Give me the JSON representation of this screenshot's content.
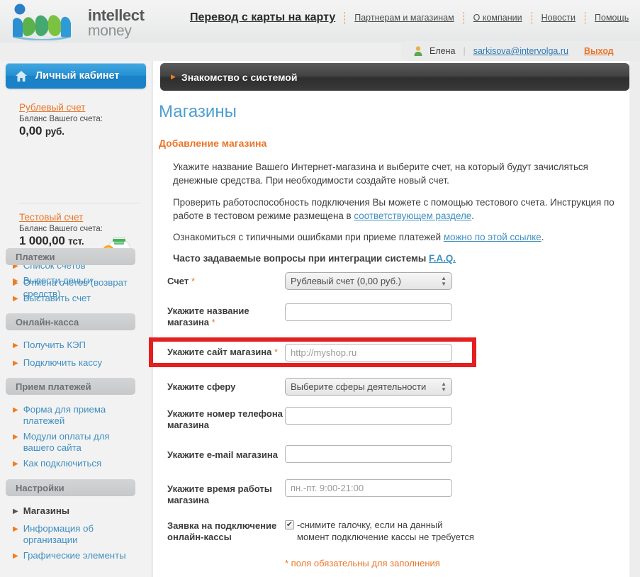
{
  "brand": {
    "name_line1": "intellect",
    "name_line2": "money",
    "logo_icon": "im-wave-logo",
    "accent_orange": "#e8762a",
    "accent_blue": "#3f8fc0",
    "highlight_red": "#e41f1f"
  },
  "topnav": {
    "primary": "Перевод с карты на карту",
    "items": [
      "Партнерам и магазинам",
      "О компании",
      "Новости",
      "Помощь"
    ]
  },
  "userbar": {
    "avatar_icon": "user-icon",
    "name": "Елена",
    "divider": "|",
    "email": "sarkisova@intervolga.ru",
    "logout": "Выход"
  },
  "sidebar": {
    "cabinet_button": {
      "icon": "home-icon",
      "label": "Личный кабинет"
    },
    "accounts": [
      {
        "link": "Рублевый счет",
        "balance_label": "Баланс Вашего счета:",
        "amount": "0,00",
        "currency": "руб."
      },
      {
        "link": "Тестовый счет",
        "balance_label": "Баланс Вашего счета:",
        "amount": "1 000,00",
        "currency": "тст.",
        "icon": "piggy-bank-icon"
      }
    ],
    "top_links": [
      "Список счетов",
      "Отмена счетов (возврат средств)"
    ],
    "groups": [
      {
        "title": "Платежи",
        "items": [
          "Вывести деньги",
          "Выставить счет"
        ]
      },
      {
        "title": "Онлайн-касса",
        "items": [
          "Получить КЭП",
          "Подключить кассу"
        ]
      },
      {
        "title": "Прием платежей",
        "items": [
          "Форма для приема платежей",
          "Модули оплаты для вашего сайта",
          "Как подключиться"
        ]
      },
      {
        "title": "Настройки",
        "items": [
          "Магазины",
          "Информация об организации",
          "Графические элементы"
        ]
      }
    ],
    "active_item": "Магазины"
  },
  "content": {
    "intro_bar": {
      "arrow_icon": "triangle-right-icon",
      "label": "Знакомство с системой"
    },
    "page_title": "Магазины",
    "section_title": "Добавление магазина",
    "paragraph1": "Укажите название Вашего Интернет-магазина и выберите счет, на который будут зачисляться денежные средства. При необходимости создайте новый счет.",
    "paragraph2_before": "Проверить работоспособность подключения Вы можете с помощью тестового счета. Инструкция по работе в тестовом режиме размещена в ",
    "paragraph2_link": "соответствующем разделе",
    "paragraph2_after": ".",
    "paragraph3_before": "Ознакомиться с типичными ошибками при приеме платежей ",
    "paragraph3_link": "можно по этой ссылке",
    "paragraph3_after": ".",
    "paragraph4_before": "Часто задаваемые вопросы при интеграции системы ",
    "paragraph4_link": "F.A.Q.",
    "paragraph4_after": ""
  },
  "form": {
    "account": {
      "label": "Счет",
      "required": "*",
      "selected": "Рублевый счет (0,00 руб.)"
    },
    "shop_name": {
      "label": "Укажите название магазина",
      "required": "*",
      "value": "",
      "placeholder": ""
    },
    "shop_site": {
      "label": "Укажите сайт магазина",
      "required": "*",
      "value": "",
      "placeholder": "http://myshop.ru",
      "highlighted": true
    },
    "sphere": {
      "label": "Укажите сферу",
      "required": "",
      "selected": "Выберите сферы деятельности"
    },
    "phone": {
      "label": "Укажите номер телефона магазина",
      "required": "",
      "value": "",
      "placeholder": ""
    },
    "email": {
      "label": "Укажите e-mail магазина",
      "required": "",
      "value": "",
      "placeholder": ""
    },
    "worktime": {
      "label": "Укажите время работы магазина",
      "required": "",
      "value": "",
      "placeholder": "пн.-пт. 9:00-21:00"
    },
    "cashbox": {
      "label": "Заявка на подключение онлайн-кассы",
      "checked": true,
      "check_glyph": "✔",
      "note": "-снимите галочку, если на данный момент подключение кассы не требуется"
    },
    "required_note": "* поля обязательны для заполнения"
  }
}
